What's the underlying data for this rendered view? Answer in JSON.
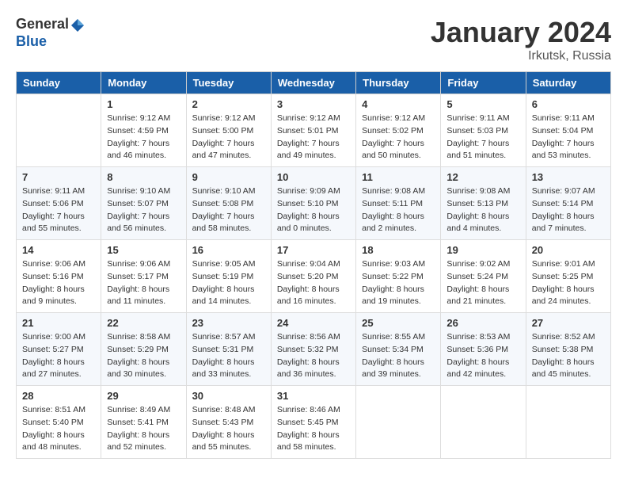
{
  "header": {
    "logo_general": "General",
    "logo_blue": "Blue",
    "month": "January 2024",
    "location": "Irkutsk, Russia"
  },
  "days_of_week": [
    "Sunday",
    "Monday",
    "Tuesday",
    "Wednesday",
    "Thursday",
    "Friday",
    "Saturday"
  ],
  "weeks": [
    [
      {
        "day": "",
        "sunrise": "",
        "sunset": "",
        "daylight": ""
      },
      {
        "day": "1",
        "sunrise": "Sunrise: 9:12 AM",
        "sunset": "Sunset: 4:59 PM",
        "daylight": "Daylight: 7 hours and 46 minutes."
      },
      {
        "day": "2",
        "sunrise": "Sunrise: 9:12 AM",
        "sunset": "Sunset: 5:00 PM",
        "daylight": "Daylight: 7 hours and 47 minutes."
      },
      {
        "day": "3",
        "sunrise": "Sunrise: 9:12 AM",
        "sunset": "Sunset: 5:01 PM",
        "daylight": "Daylight: 7 hours and 49 minutes."
      },
      {
        "day": "4",
        "sunrise": "Sunrise: 9:12 AM",
        "sunset": "Sunset: 5:02 PM",
        "daylight": "Daylight: 7 hours and 50 minutes."
      },
      {
        "day": "5",
        "sunrise": "Sunrise: 9:11 AM",
        "sunset": "Sunset: 5:03 PM",
        "daylight": "Daylight: 7 hours and 51 minutes."
      },
      {
        "day": "6",
        "sunrise": "Sunrise: 9:11 AM",
        "sunset": "Sunset: 5:04 PM",
        "daylight": "Daylight: 7 hours and 53 minutes."
      }
    ],
    [
      {
        "day": "7",
        "sunrise": "Sunrise: 9:11 AM",
        "sunset": "Sunset: 5:06 PM",
        "daylight": "Daylight: 7 hours and 55 minutes."
      },
      {
        "day": "8",
        "sunrise": "Sunrise: 9:10 AM",
        "sunset": "Sunset: 5:07 PM",
        "daylight": "Daylight: 7 hours and 56 minutes."
      },
      {
        "day": "9",
        "sunrise": "Sunrise: 9:10 AM",
        "sunset": "Sunset: 5:08 PM",
        "daylight": "Daylight: 7 hours and 58 minutes."
      },
      {
        "day": "10",
        "sunrise": "Sunrise: 9:09 AM",
        "sunset": "Sunset: 5:10 PM",
        "daylight": "Daylight: 8 hours and 0 minutes."
      },
      {
        "day": "11",
        "sunrise": "Sunrise: 9:08 AM",
        "sunset": "Sunset: 5:11 PM",
        "daylight": "Daylight: 8 hours and 2 minutes."
      },
      {
        "day": "12",
        "sunrise": "Sunrise: 9:08 AM",
        "sunset": "Sunset: 5:13 PM",
        "daylight": "Daylight: 8 hours and 4 minutes."
      },
      {
        "day": "13",
        "sunrise": "Sunrise: 9:07 AM",
        "sunset": "Sunset: 5:14 PM",
        "daylight": "Daylight: 8 hours and 7 minutes."
      }
    ],
    [
      {
        "day": "14",
        "sunrise": "Sunrise: 9:06 AM",
        "sunset": "Sunset: 5:16 PM",
        "daylight": "Daylight: 8 hours and 9 minutes."
      },
      {
        "day": "15",
        "sunrise": "Sunrise: 9:06 AM",
        "sunset": "Sunset: 5:17 PM",
        "daylight": "Daylight: 8 hours and 11 minutes."
      },
      {
        "day": "16",
        "sunrise": "Sunrise: 9:05 AM",
        "sunset": "Sunset: 5:19 PM",
        "daylight": "Daylight: 8 hours and 14 minutes."
      },
      {
        "day": "17",
        "sunrise": "Sunrise: 9:04 AM",
        "sunset": "Sunset: 5:20 PM",
        "daylight": "Daylight: 8 hours and 16 minutes."
      },
      {
        "day": "18",
        "sunrise": "Sunrise: 9:03 AM",
        "sunset": "Sunset: 5:22 PM",
        "daylight": "Daylight: 8 hours and 19 minutes."
      },
      {
        "day": "19",
        "sunrise": "Sunrise: 9:02 AM",
        "sunset": "Sunset: 5:24 PM",
        "daylight": "Daylight: 8 hours and 21 minutes."
      },
      {
        "day": "20",
        "sunrise": "Sunrise: 9:01 AM",
        "sunset": "Sunset: 5:25 PM",
        "daylight": "Daylight: 8 hours and 24 minutes."
      }
    ],
    [
      {
        "day": "21",
        "sunrise": "Sunrise: 9:00 AM",
        "sunset": "Sunset: 5:27 PM",
        "daylight": "Daylight: 8 hours and 27 minutes."
      },
      {
        "day": "22",
        "sunrise": "Sunrise: 8:58 AM",
        "sunset": "Sunset: 5:29 PM",
        "daylight": "Daylight: 8 hours and 30 minutes."
      },
      {
        "day": "23",
        "sunrise": "Sunrise: 8:57 AM",
        "sunset": "Sunset: 5:31 PM",
        "daylight": "Daylight: 8 hours and 33 minutes."
      },
      {
        "day": "24",
        "sunrise": "Sunrise: 8:56 AM",
        "sunset": "Sunset: 5:32 PM",
        "daylight": "Daylight: 8 hours and 36 minutes."
      },
      {
        "day": "25",
        "sunrise": "Sunrise: 8:55 AM",
        "sunset": "Sunset: 5:34 PM",
        "daylight": "Daylight: 8 hours and 39 minutes."
      },
      {
        "day": "26",
        "sunrise": "Sunrise: 8:53 AM",
        "sunset": "Sunset: 5:36 PM",
        "daylight": "Daylight: 8 hours and 42 minutes."
      },
      {
        "day": "27",
        "sunrise": "Sunrise: 8:52 AM",
        "sunset": "Sunset: 5:38 PM",
        "daylight": "Daylight: 8 hours and 45 minutes."
      }
    ],
    [
      {
        "day": "28",
        "sunrise": "Sunrise: 8:51 AM",
        "sunset": "Sunset: 5:40 PM",
        "daylight": "Daylight: 8 hours and 48 minutes."
      },
      {
        "day": "29",
        "sunrise": "Sunrise: 8:49 AM",
        "sunset": "Sunset: 5:41 PM",
        "daylight": "Daylight: 8 hours and 52 minutes."
      },
      {
        "day": "30",
        "sunrise": "Sunrise: 8:48 AM",
        "sunset": "Sunset: 5:43 PM",
        "daylight": "Daylight: 8 hours and 55 minutes."
      },
      {
        "day": "31",
        "sunrise": "Sunrise: 8:46 AM",
        "sunset": "Sunset: 5:45 PM",
        "daylight": "Daylight: 8 hours and 58 minutes."
      },
      {
        "day": "",
        "sunrise": "",
        "sunset": "",
        "daylight": ""
      },
      {
        "day": "",
        "sunrise": "",
        "sunset": "",
        "daylight": ""
      },
      {
        "day": "",
        "sunrise": "",
        "sunset": "",
        "daylight": ""
      }
    ]
  ]
}
